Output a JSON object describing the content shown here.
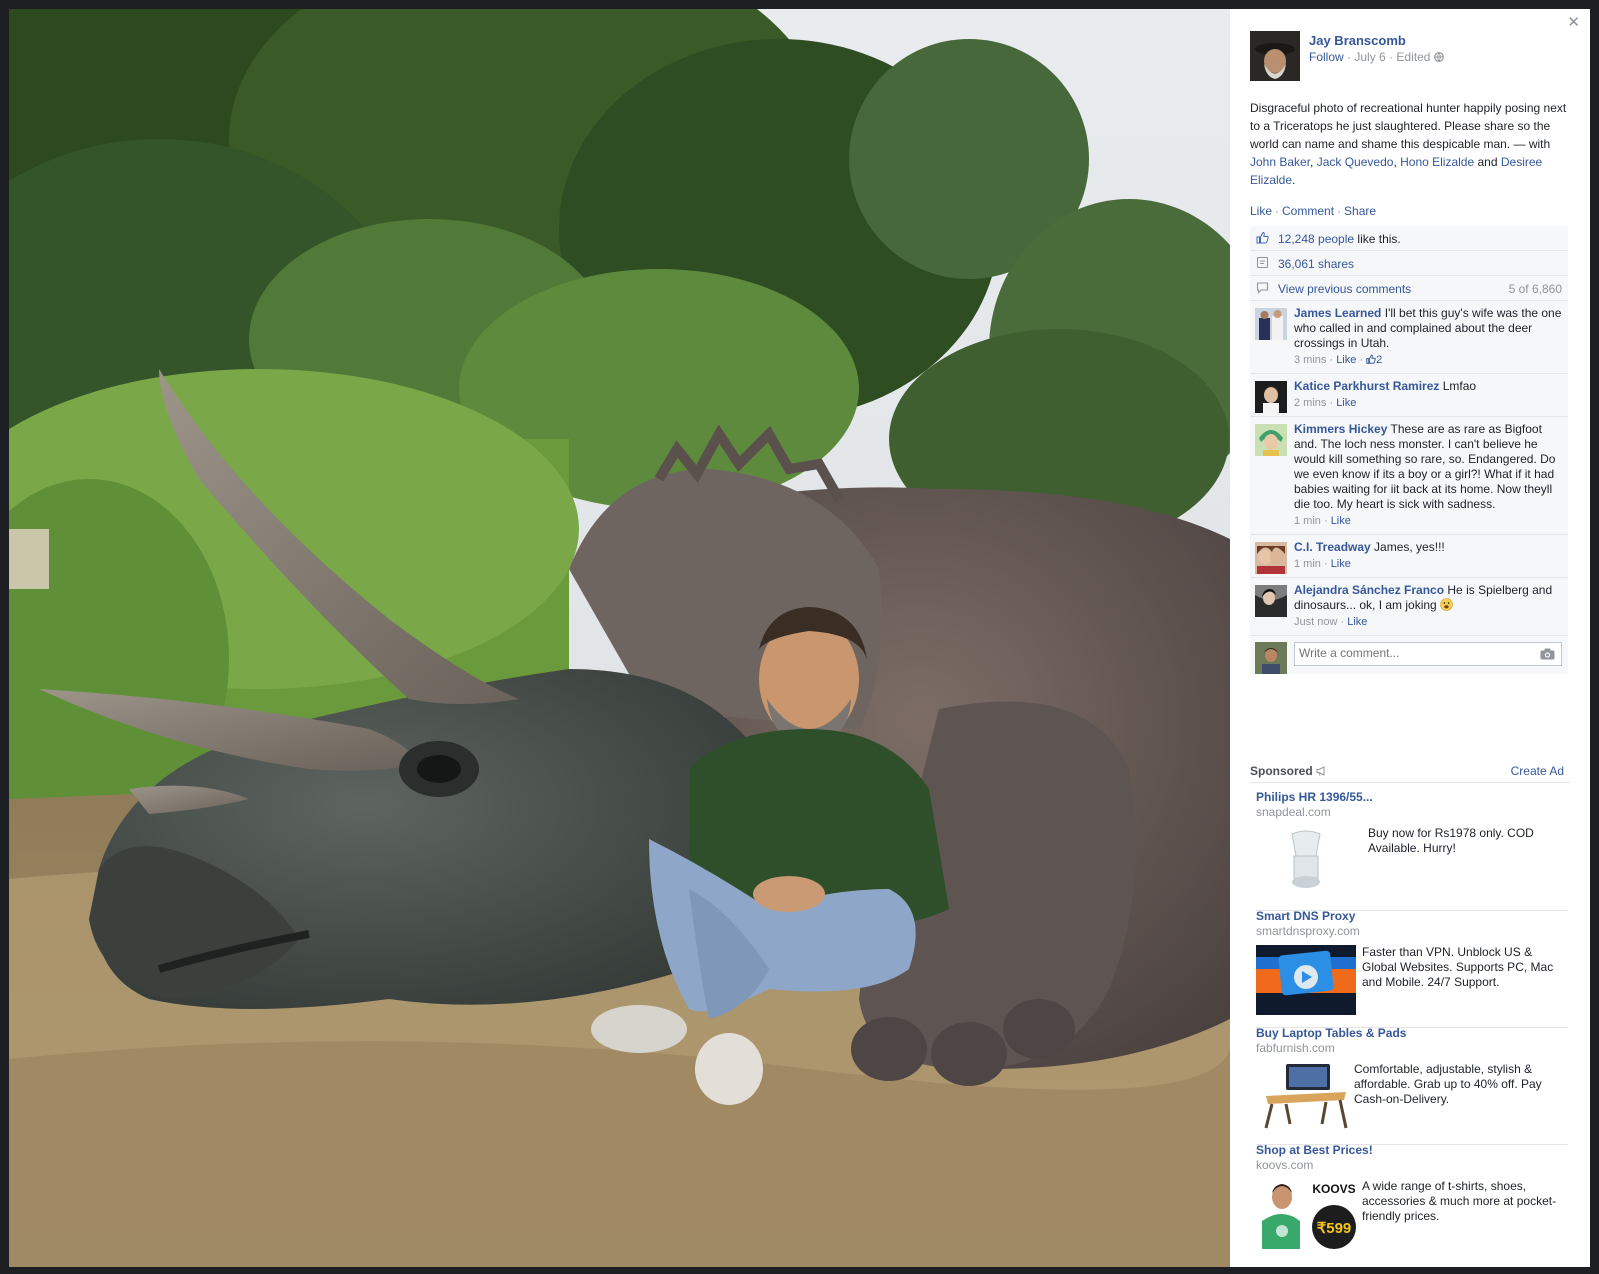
{
  "post": {
    "author": "Jay Branscomb",
    "follow": "Follow",
    "date": "July 6",
    "edited": "Edited",
    "text_main": "Disgraceful photo of recreational hunter happily posing next to a Triceratops he just slaughtered. Please share so the world can name and shame this despicable man. — with ",
    "tags": [
      "John Baker",
      "Jack Quevedo",
      "Hono Elizalde",
      "Desiree Elizalde"
    ],
    "tag_sep1": ", ",
    "tag_sep2": ", ",
    "tag_and": " and ",
    "tag_end": "."
  },
  "actions": {
    "like": "Like",
    "comment": "Comment",
    "share": "Share"
  },
  "ufi": {
    "likes_link": "12,248 people",
    "likes_suffix": " like this.",
    "shares": "36,061 shares",
    "previous": "View previous comments",
    "count": "5 of 6,860"
  },
  "comments": [
    {
      "name": "James Learned",
      "text": "I'll bet this guy's wife was the one who called in and complained about the deer crossings in Utah.",
      "time": "3 mins",
      "like": "Like",
      "likes": "2"
    },
    {
      "name": "Katice Parkhurst Ramirez",
      "text": "Lmfao",
      "time": "2 mins",
      "like": "Like"
    },
    {
      "name": "Kimmers Hickey",
      "text": "These are as rare as Bigfoot and. The loch ness monster. I can't believe he would kill something so rare, so. Endangered. Do we even know if its a boy or a girl?! What if it had babies waiting for iit back at its home. Now theyll die too. My heart is sick with sadness.",
      "time": "1 min",
      "like": "Like"
    },
    {
      "name": "C.I. Treadway",
      "text": "James, yes!!!",
      "time": "1 min",
      "like": "Like"
    },
    {
      "name": "Alejandra Sánchez Franco",
      "text": "He is Spielberg and dinosaurs... ok, I am joking",
      "time": "Just now",
      "like": "Like"
    }
  ],
  "write_comment": {
    "placeholder": "Write a comment..."
  },
  "sponsored": {
    "label": "Sponsored",
    "create_ad": "Create Ad",
    "ads": [
      {
        "title": "Philips HR 1396/55...",
        "domain": "snapdeal.com",
        "desc": "Buy now for Rs1978 only. COD Available. Hurry!"
      },
      {
        "title": "Smart DNS Proxy",
        "domain": "smartdnsproxy.com",
        "desc": "Faster than VPN. Unblock US & Global Websites. Supports PC, Mac and Mobile. 24/7 Support."
      },
      {
        "title": "Buy Laptop Tables & Pads",
        "domain": "fabfurnish.com",
        "desc": "Comfortable, adjustable, stylish & affordable. Grab up to 40% off. Pay Cash-on-Delivery."
      },
      {
        "title": "Shop at Best Prices!",
        "domain": "koovs.com",
        "desc": "A wide range of t-shirts, shoes, accessories & much more at pocket-friendly prices.",
        "brand": "KOOVS",
        "price": "₹599"
      }
    ]
  },
  "colors": {
    "link": "#365899",
    "muted": "#90949c",
    "text": "#1d2129",
    "panel_bg": "#ffffff",
    "ufi_bg": "#f6f7f9"
  },
  "icons": [
    "close-icon",
    "globe-icon",
    "thumbs-up-icon",
    "share-icon",
    "comment-bubble-icon",
    "camera-icon",
    "megaphone-icon",
    "emoji-icon"
  ]
}
